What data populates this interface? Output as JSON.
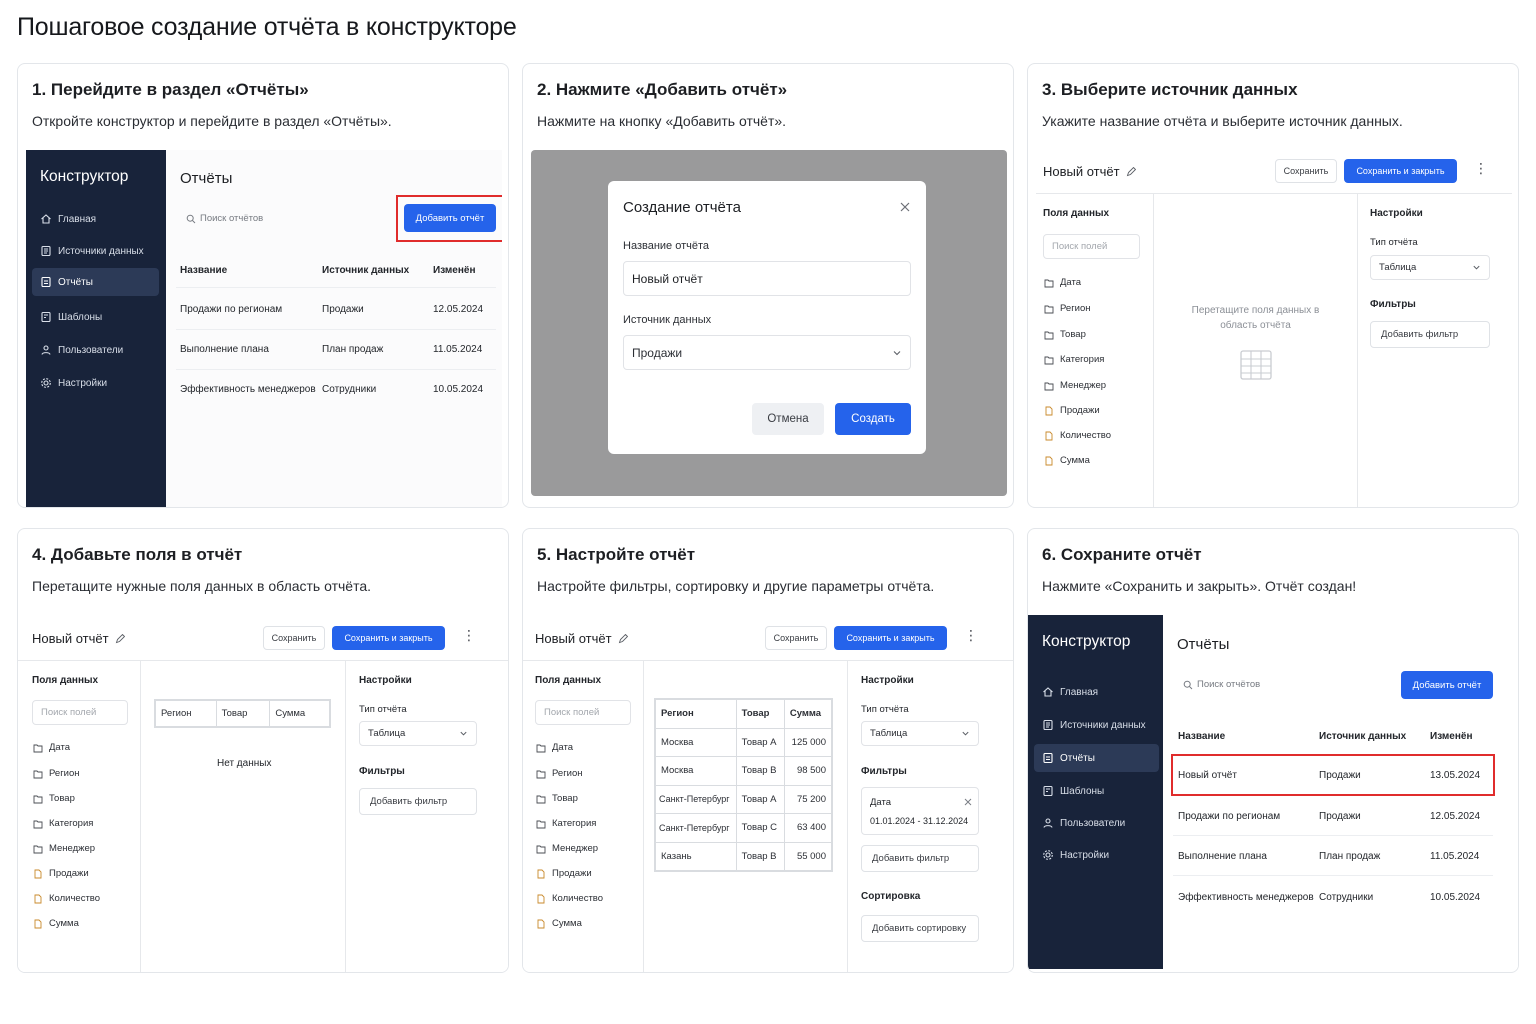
{
  "page": {
    "title": "Пошаговое создание отчёта в конструкторе"
  },
  "steps": [
    {
      "title": "1. Перейдите в раздел «Отчёты»",
      "desc": "Откройте конструктор и перейдите в раздел «Отчёты»."
    },
    {
      "title": "2. Нажмите «Добавить отчёт»",
      "desc": "Нажмите на кнопку «Добавить отчёт»."
    },
    {
      "title": "3. Выберите источник данных",
      "desc": "Укажите название отчёта и выберите источник данных."
    },
    {
      "title": "4. Добавьте поля в отчёт",
      "desc": "Перетащите нужные поля данных в область отчёта."
    },
    {
      "title": "5. Настройте отчёт",
      "desc": "Настройте фильтры, сортировку и другие параметры отчёта."
    },
    {
      "title": "6. Сохраните отчёт",
      "desc": "Нажмите «Сохранить и закрыть». Отчёт создан!"
    }
  ],
  "sidebar": {
    "title": "Конструктор",
    "items": [
      {
        "label": "Главная",
        "icon": "home-icon"
      },
      {
        "label": "Источники данных",
        "icon": "database-icon"
      },
      {
        "label": "Отчёты",
        "icon": "report-icon"
      },
      {
        "label": "Шаблоны",
        "icon": "template-icon"
      },
      {
        "label": "Пользователи",
        "icon": "users-icon"
      },
      {
        "label": "Настройки",
        "icon": "gear-icon"
      }
    ]
  },
  "reports": {
    "title": "Отчёты",
    "search_placeholder": "Поиск отчётов",
    "add_button": "Добавить отчёт",
    "columns": [
      "Название",
      "Источник данных",
      "Изменён"
    ],
    "rows": [
      [
        "Продажи по регионам",
        "Продажи",
        "12.05.2024"
      ],
      [
        "Выполнение плана",
        "План продаж",
        "11.05.2024"
      ],
      [
        "Эффективность менеджеров",
        "Сотрудники",
        "10.05.2024"
      ]
    ],
    "new_row": [
      "Новый отчёт",
      "Продажи",
      "13.05.2024"
    ]
  },
  "dialog": {
    "title": "Создание отчёта",
    "name_label": "Название отчёта",
    "name_value": "Новый отчёт",
    "source_label": "Источник данных",
    "source_value": "Продажи",
    "cancel": "Отмена",
    "create": "Создать"
  },
  "editor": {
    "title": "Новый отчёт",
    "save": "Сохранить",
    "save_close": "Сохранить и закрыть",
    "fields_header": "Поля данных",
    "fields_search": "Поиск полей",
    "fields": [
      "Дата",
      "Регион",
      "Товар",
      "Категория",
      "Менеджер",
      "Продажи",
      "Количество",
      "Сумма"
    ],
    "drop_hint": "Перетащите поля данных в область отчёта",
    "settings_header": "Настройки",
    "type_label": "Тип отчёта",
    "type_value": "Таблица",
    "filters_label": "Фильтры",
    "add_filter": "Добавить фильтр",
    "sort_label": "Сортировка",
    "add_sort": "Добавить сортировку",
    "no_data": "Нет данных",
    "table_columns": [
      "Регион",
      "Товар",
      "Сумма"
    ],
    "table_rows": [
      [
        "Москва",
        "Товар A",
        "125 000"
      ],
      [
        "Москва",
        "Товар B",
        "98 500"
      ],
      [
        "Санкт-Петербург",
        "Товар A",
        "75 200"
      ],
      [
        "Санкт-Петербург",
        "Товар C",
        "63 400"
      ],
      [
        "Казань",
        "Товар B",
        "55 000"
      ]
    ],
    "filter_date_label": "Дата",
    "filter_date_range": "01.01.2024 - 31.12.2024"
  },
  "colors": {
    "accent": "#2563eb",
    "sidebar": "#18233a",
    "highlight": "#e02c2c"
  }
}
